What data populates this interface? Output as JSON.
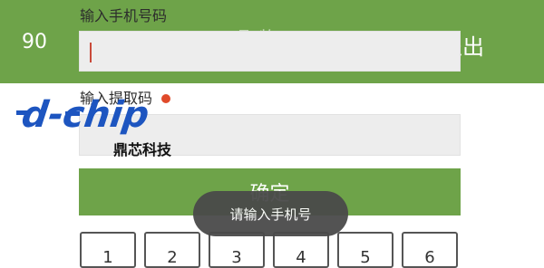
{
  "header": {
    "counter": "90",
    "center_text": "取物",
    "logout_label": "退出"
  },
  "phone": {
    "label": "输入手机号码",
    "value": "",
    "placeholder": ""
  },
  "code": {
    "label": "输入提取码",
    "value": "",
    "placeholder": ""
  },
  "confirm_label": "确定",
  "toast_text": "请输入手机号",
  "keypad": {
    "keys": [
      "1",
      "2",
      "3",
      "4",
      "5",
      "6"
    ]
  },
  "watermark": {
    "logo_text": "d-chip",
    "company_name": "鼎芯科技",
    "colors": {
      "blue": "#1d55c0",
      "red": "#e04a2a"
    }
  },
  "colors": {
    "accent_green": "#6ea349",
    "input_bg": "#ededed",
    "toast_bg": "#4a4a4a"
  }
}
